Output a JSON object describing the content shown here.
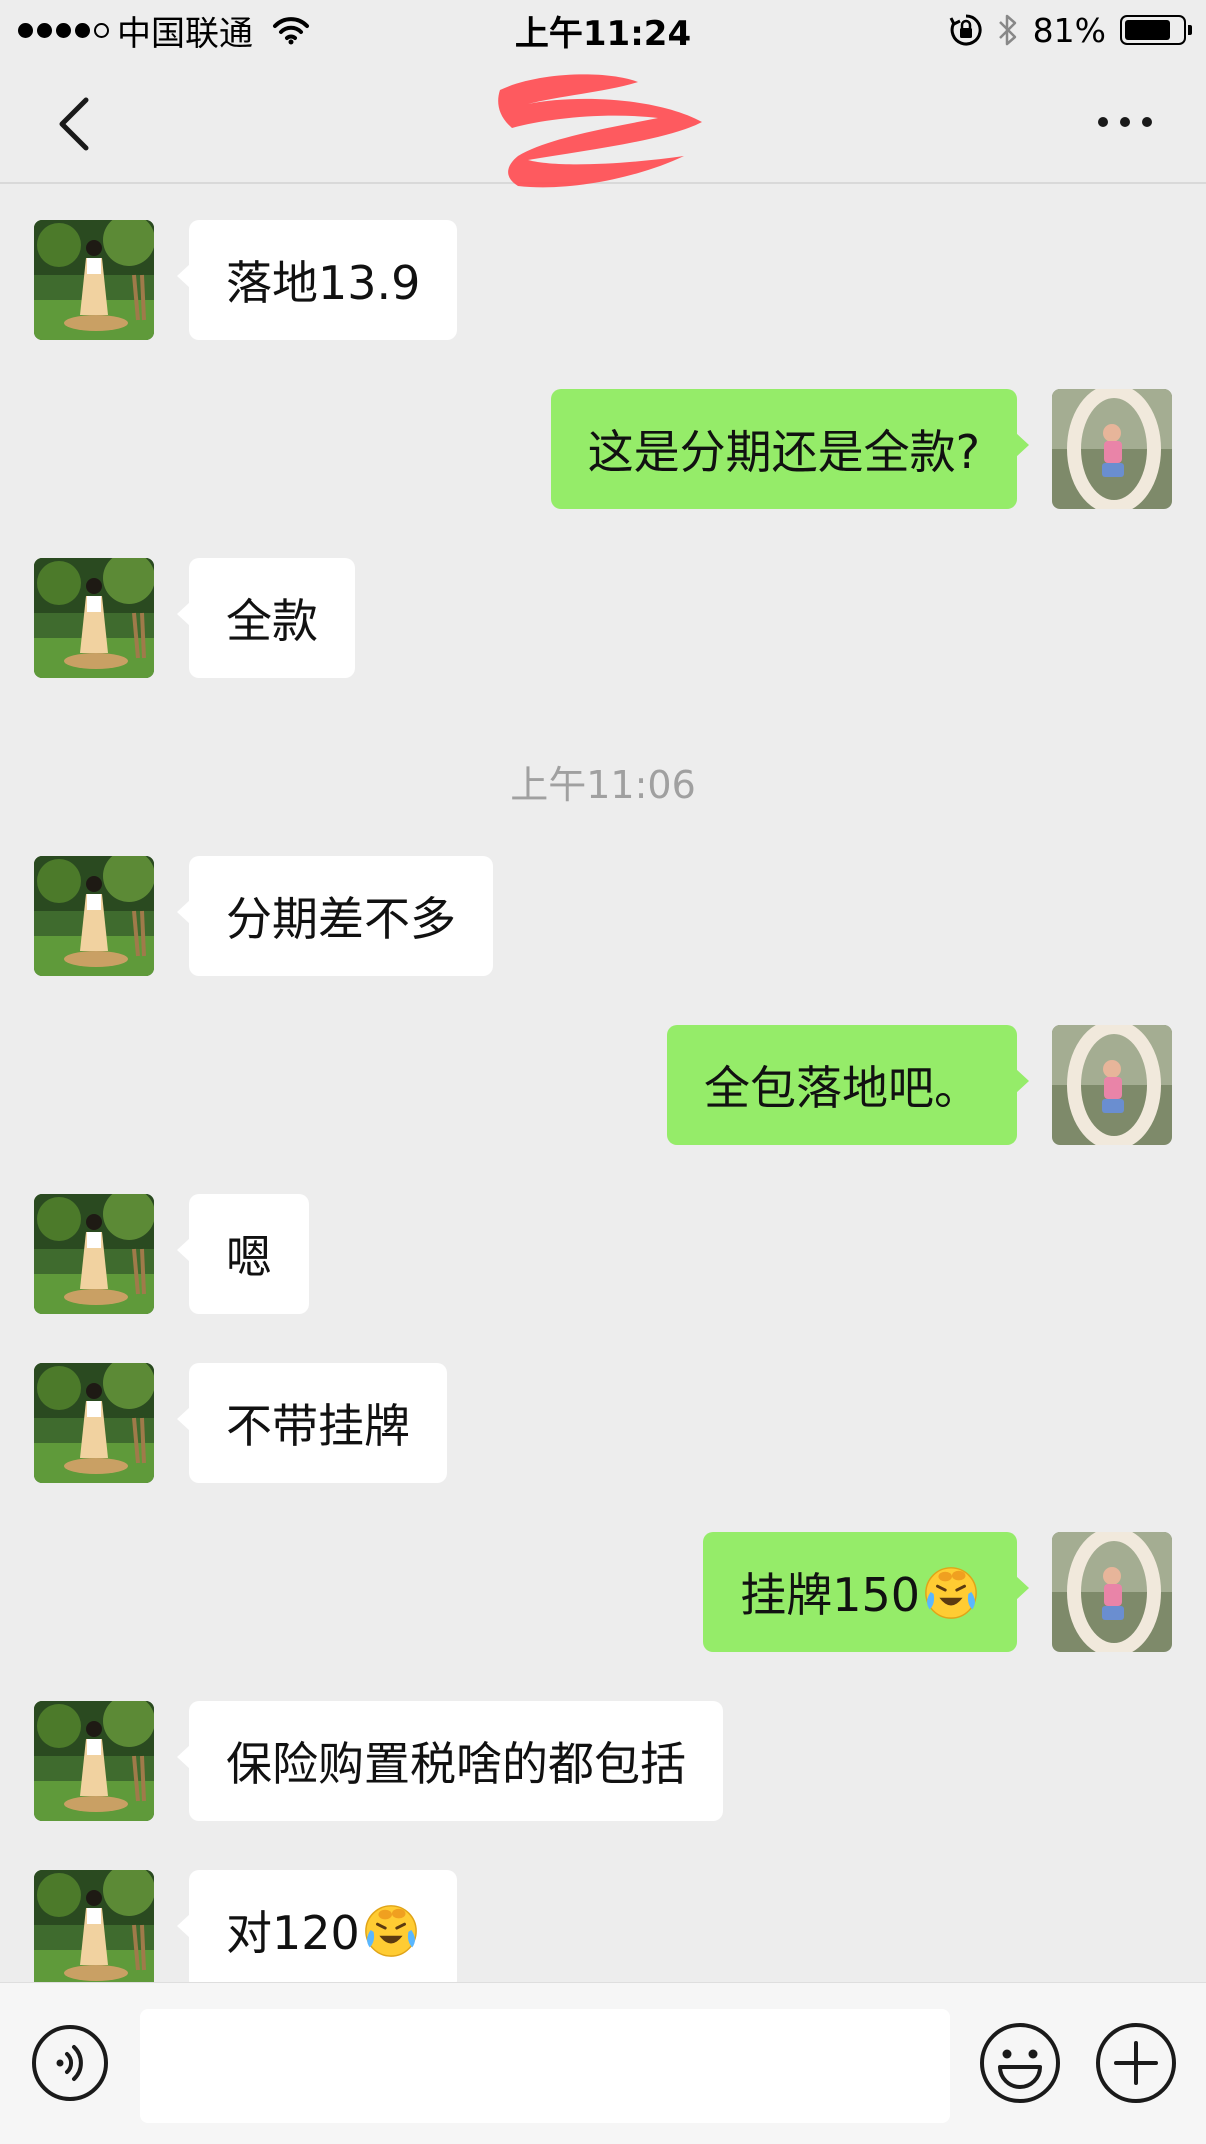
{
  "status_bar": {
    "carrier": "中国联通",
    "time": "上午11:24",
    "battery": "81%",
    "battery_level": 0.81,
    "icons": [
      "signal-dots-icon",
      "wifi-icon",
      "rotation-lock-icon",
      "bluetooth-icon",
      "battery-icon"
    ]
  },
  "nav": {
    "back_icon": "chevron-left-icon",
    "more_icon": "more-dots-icon"
  },
  "messages": [
    {
      "side": "in",
      "text": "落地13.9"
    },
    {
      "side": "out",
      "text": "这是分期还是全款?"
    },
    {
      "side": "in",
      "text": "全款"
    },
    {
      "side": "in",
      "text": "分期差不多"
    },
    {
      "side": "out",
      "text": "全包落地吧。"
    },
    {
      "side": "in",
      "text": "嗯"
    },
    {
      "side": "in",
      "text": "不带挂牌"
    },
    {
      "side": "out",
      "text": "挂牌150",
      "emoji": "laughing-crying-emoji"
    },
    {
      "side": "in",
      "text": "保险购置税啥的都包括"
    },
    {
      "side": "in",
      "text": "对120",
      "emoji": "laughing-crying-emoji"
    }
  ],
  "timestamp": "上午11:06",
  "input_bar": {
    "voice_icon": "voice-icon",
    "emoji_icon": "emoji-icon",
    "plus_icon": "plus-icon",
    "placeholder": ""
  },
  "colors": {
    "background": "#ededed",
    "incoming_bubble": "#ffffff",
    "outgoing_bubble": "#95ec69",
    "timestamp": "#a0a0a0"
  }
}
